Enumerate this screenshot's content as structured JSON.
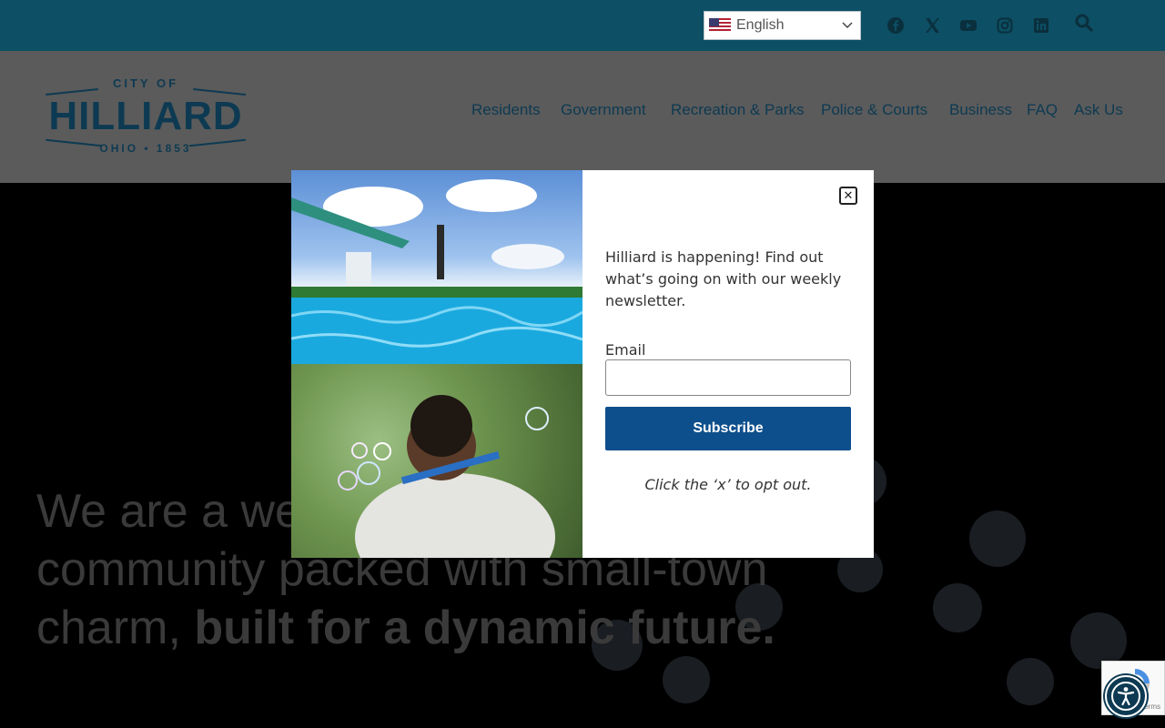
{
  "topbar": {
    "language": "English",
    "social_icons": [
      "facebook-icon",
      "x-twitter-icon",
      "youtube-icon",
      "instagram-icon",
      "linkedin-icon"
    ],
    "search_icon": "search-icon",
    "background": "#0d4f64"
  },
  "header": {
    "logo": {
      "top": "CITY OF",
      "main": "HILLIARD",
      "bottom": "OHIO • 1853"
    },
    "nav": [
      "Residents",
      "Government",
      "Recreation & Parks",
      "Police & Courts",
      "Business",
      "FAQ",
      "Ask Us"
    ]
  },
  "hero": {
    "text_light_1": "We are a we",
    "text_light_2": "community packed with small-town",
    "text_light_3": "charm, ",
    "text_bold": "built for a dynamic future."
  },
  "modal": {
    "intro": "Hilliard is happening! Find out what’s going on with our weekly newsletter.",
    "email_label": "Email",
    "email_value": "",
    "subscribe_label": "Subscribe",
    "optout": "Click the ‘x’ to opt out.",
    "close_symbol": "✕",
    "subscribe_color": "#0d4f8c"
  },
  "recaptcha": {
    "text": "erms"
  },
  "colors": {
    "brand_navy": "#0d3a52",
    "overlay": "#000000"
  }
}
